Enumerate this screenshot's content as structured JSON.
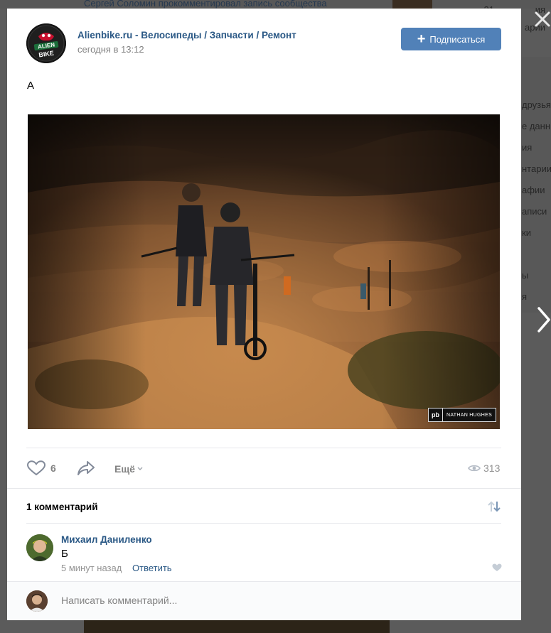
{
  "background": {
    "feed_text": "Сергей Соломин прокомментировал запись сообщества",
    "right_top": [
      "21",
      "ия",
      "арии"
    ],
    "right_column": [
      "друзья",
      "е данн",
      "ия",
      "нтарии",
      "афии",
      "аписи",
      "ки",
      "ы",
      "я"
    ]
  },
  "post": {
    "group_name": "Alienbike.ru - Велосипеды / Запчасти / Ремонт",
    "time": "сегодня в 13:12",
    "subscribe_label": "Подписаться",
    "text": "А",
    "photo": {
      "watermark_logo": "pb",
      "watermark_credit": "NATHAN HUGHES"
    },
    "likes": "6",
    "more_label": "Ещё",
    "views": "313"
  },
  "comments": {
    "count_label": "1 комментарий",
    "items": [
      {
        "author": "Михаил Даниленко",
        "text": "Б",
        "time": "5 минут назад",
        "reply_label": "Ответить"
      }
    ],
    "input_placeholder": "Написать комментарий..."
  },
  "colors": {
    "link": "#2a5885",
    "button": "#5181b8",
    "muted": "#828282"
  }
}
